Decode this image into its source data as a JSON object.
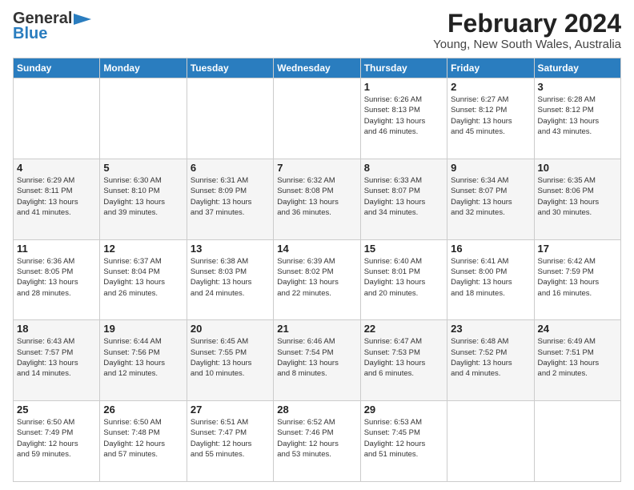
{
  "logo": {
    "line1": "General",
    "line2": "Blue"
  },
  "title": "February 2024",
  "subtitle": "Young, New South Wales, Australia",
  "days_of_week": [
    "Sunday",
    "Monday",
    "Tuesday",
    "Wednesday",
    "Thursday",
    "Friday",
    "Saturday"
  ],
  "weeks": [
    [
      {
        "day": "",
        "info": ""
      },
      {
        "day": "",
        "info": ""
      },
      {
        "day": "",
        "info": ""
      },
      {
        "day": "",
        "info": ""
      },
      {
        "day": "1",
        "info": "Sunrise: 6:26 AM\nSunset: 8:13 PM\nDaylight: 13 hours\nand 46 minutes."
      },
      {
        "day": "2",
        "info": "Sunrise: 6:27 AM\nSunset: 8:12 PM\nDaylight: 13 hours\nand 45 minutes."
      },
      {
        "day": "3",
        "info": "Sunrise: 6:28 AM\nSunset: 8:12 PM\nDaylight: 13 hours\nand 43 minutes."
      }
    ],
    [
      {
        "day": "4",
        "info": "Sunrise: 6:29 AM\nSunset: 8:11 PM\nDaylight: 13 hours\nand 41 minutes."
      },
      {
        "day": "5",
        "info": "Sunrise: 6:30 AM\nSunset: 8:10 PM\nDaylight: 13 hours\nand 39 minutes."
      },
      {
        "day": "6",
        "info": "Sunrise: 6:31 AM\nSunset: 8:09 PM\nDaylight: 13 hours\nand 37 minutes."
      },
      {
        "day": "7",
        "info": "Sunrise: 6:32 AM\nSunset: 8:08 PM\nDaylight: 13 hours\nand 36 minutes."
      },
      {
        "day": "8",
        "info": "Sunrise: 6:33 AM\nSunset: 8:07 PM\nDaylight: 13 hours\nand 34 minutes."
      },
      {
        "day": "9",
        "info": "Sunrise: 6:34 AM\nSunset: 8:07 PM\nDaylight: 13 hours\nand 32 minutes."
      },
      {
        "day": "10",
        "info": "Sunrise: 6:35 AM\nSunset: 8:06 PM\nDaylight: 13 hours\nand 30 minutes."
      }
    ],
    [
      {
        "day": "11",
        "info": "Sunrise: 6:36 AM\nSunset: 8:05 PM\nDaylight: 13 hours\nand 28 minutes."
      },
      {
        "day": "12",
        "info": "Sunrise: 6:37 AM\nSunset: 8:04 PM\nDaylight: 13 hours\nand 26 minutes."
      },
      {
        "day": "13",
        "info": "Sunrise: 6:38 AM\nSunset: 8:03 PM\nDaylight: 13 hours\nand 24 minutes."
      },
      {
        "day": "14",
        "info": "Sunrise: 6:39 AM\nSunset: 8:02 PM\nDaylight: 13 hours\nand 22 minutes."
      },
      {
        "day": "15",
        "info": "Sunrise: 6:40 AM\nSunset: 8:01 PM\nDaylight: 13 hours\nand 20 minutes."
      },
      {
        "day": "16",
        "info": "Sunrise: 6:41 AM\nSunset: 8:00 PM\nDaylight: 13 hours\nand 18 minutes."
      },
      {
        "day": "17",
        "info": "Sunrise: 6:42 AM\nSunset: 7:59 PM\nDaylight: 13 hours\nand 16 minutes."
      }
    ],
    [
      {
        "day": "18",
        "info": "Sunrise: 6:43 AM\nSunset: 7:57 PM\nDaylight: 13 hours\nand 14 minutes."
      },
      {
        "day": "19",
        "info": "Sunrise: 6:44 AM\nSunset: 7:56 PM\nDaylight: 13 hours\nand 12 minutes."
      },
      {
        "day": "20",
        "info": "Sunrise: 6:45 AM\nSunset: 7:55 PM\nDaylight: 13 hours\nand 10 minutes."
      },
      {
        "day": "21",
        "info": "Sunrise: 6:46 AM\nSunset: 7:54 PM\nDaylight: 13 hours\nand 8 minutes."
      },
      {
        "day": "22",
        "info": "Sunrise: 6:47 AM\nSunset: 7:53 PM\nDaylight: 13 hours\nand 6 minutes."
      },
      {
        "day": "23",
        "info": "Sunrise: 6:48 AM\nSunset: 7:52 PM\nDaylight: 13 hours\nand 4 minutes."
      },
      {
        "day": "24",
        "info": "Sunrise: 6:49 AM\nSunset: 7:51 PM\nDaylight: 13 hours\nand 2 minutes."
      }
    ],
    [
      {
        "day": "25",
        "info": "Sunrise: 6:50 AM\nSunset: 7:49 PM\nDaylight: 12 hours\nand 59 minutes."
      },
      {
        "day": "26",
        "info": "Sunrise: 6:50 AM\nSunset: 7:48 PM\nDaylight: 12 hours\nand 57 minutes."
      },
      {
        "day": "27",
        "info": "Sunrise: 6:51 AM\nSunset: 7:47 PM\nDaylight: 12 hours\nand 55 minutes."
      },
      {
        "day": "28",
        "info": "Sunrise: 6:52 AM\nSunset: 7:46 PM\nDaylight: 12 hours\nand 53 minutes."
      },
      {
        "day": "29",
        "info": "Sunrise: 6:53 AM\nSunset: 7:45 PM\nDaylight: 12 hours\nand 51 minutes."
      },
      {
        "day": "",
        "info": ""
      },
      {
        "day": "",
        "info": ""
      }
    ]
  ]
}
